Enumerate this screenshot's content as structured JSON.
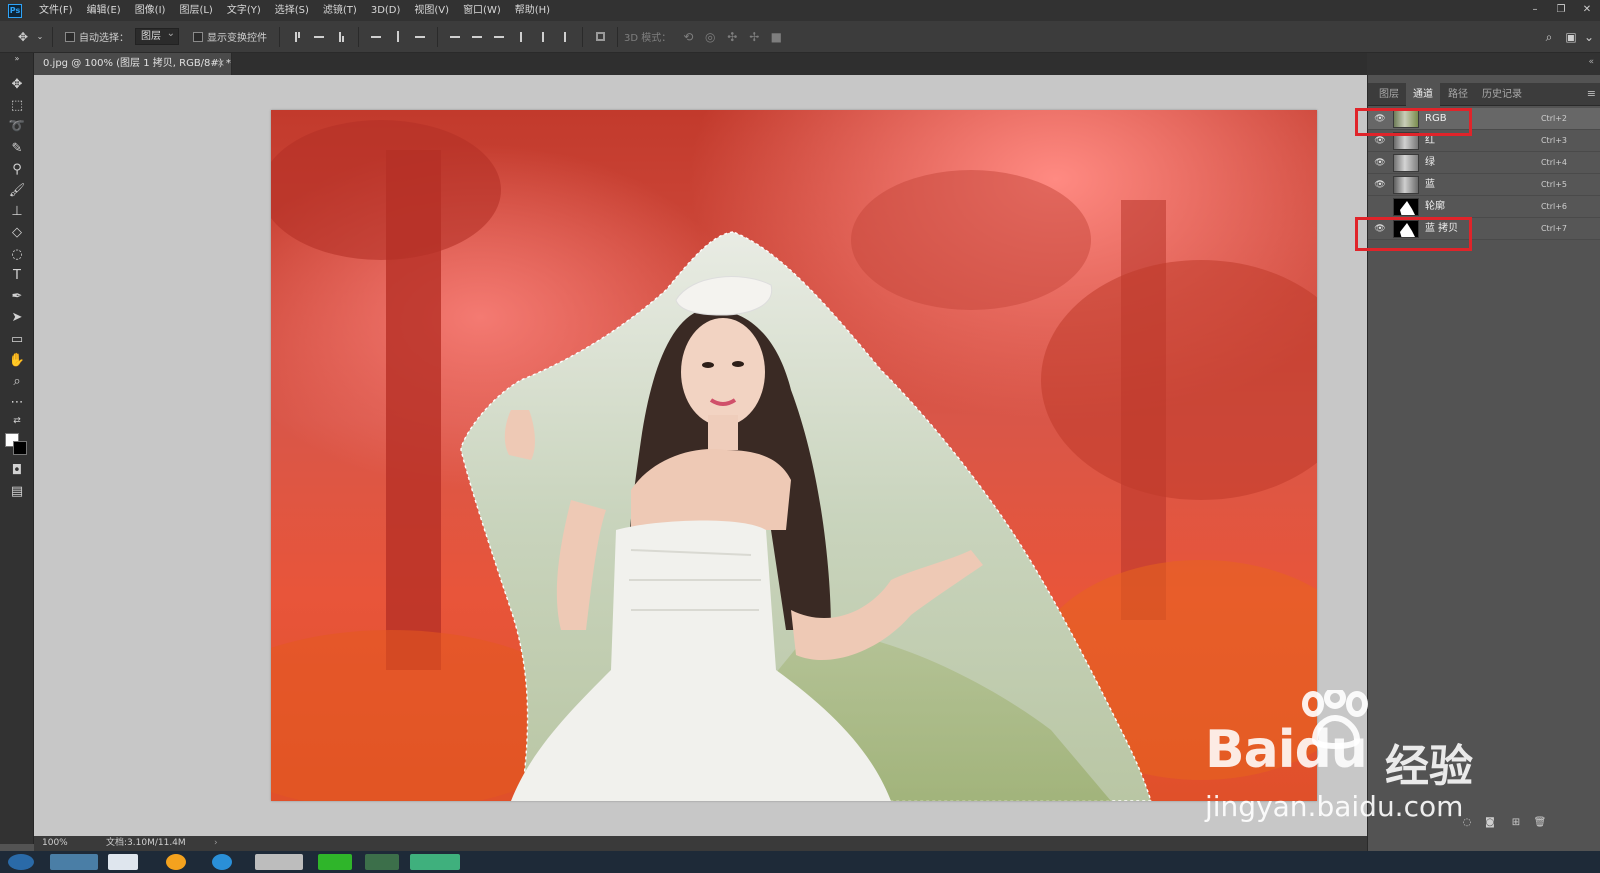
{
  "app": {
    "logo": "Ps"
  },
  "menu": [
    "文件(F)",
    "编辑(E)",
    "图像(I)",
    "图层(L)",
    "文字(Y)",
    "选择(S)",
    "滤镜(T)",
    "3D(D)",
    "视图(V)",
    "窗口(W)",
    "帮助(H)"
  ],
  "options": {
    "auto_select_label": "自动选择：",
    "auto_select_value": "图层",
    "show_transform_label": "显示变换控件",
    "mode_3d_label": "3D 模式："
  },
  "document": {
    "tab_title": "0.jpg @ 100% (图层 1 拷贝, RGB/8#) *",
    "close": "×"
  },
  "status": {
    "zoom": "100%",
    "doc_size": "文档:3.10M/11.4M",
    "arrow": "›"
  },
  "panel": {
    "tabs": [
      "图层",
      "通道",
      "路径",
      "历史记录"
    ],
    "active_tab": "通道",
    "channels": [
      {
        "name": "RGB",
        "shortcut": "Ctrl+2",
        "visible": true,
        "thumb": "color"
      },
      {
        "name": "红",
        "shortcut": "Ctrl+3",
        "visible": true,
        "thumb": "gray"
      },
      {
        "name": "绿",
        "shortcut": "Ctrl+4",
        "visible": true,
        "thumb": "gray"
      },
      {
        "name": "蓝",
        "shortcut": "Ctrl+5",
        "visible": true,
        "thumb": "gray"
      },
      {
        "name": "轮廓",
        "shortcut": "Ctrl+6",
        "visible": false,
        "thumb": "mask"
      },
      {
        "name": "蓝 拷贝",
        "shortcut": "Ctrl+7",
        "visible": true,
        "thumb": "mask"
      }
    ]
  },
  "watermark": {
    "brand_bai": "Bai",
    "brand_du": "du",
    "brand_cn": "经验",
    "url": "jingyan.baidu.com"
  },
  "colors": {
    "highlight": "#e0242a",
    "quick_mask": "#f06a66",
    "canvas_bg": "#c7c7c7"
  }
}
